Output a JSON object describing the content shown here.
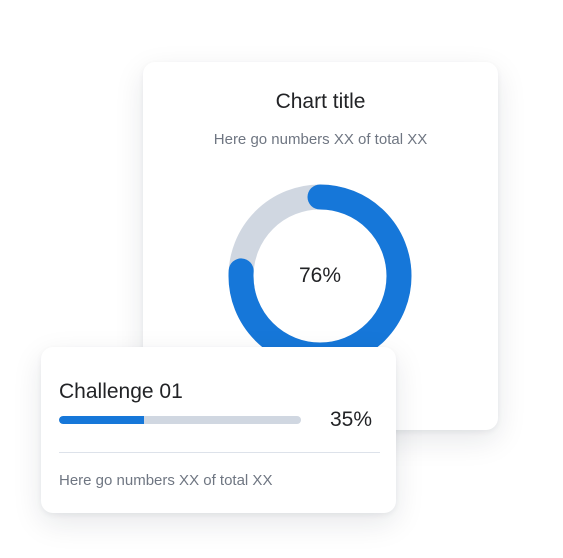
{
  "chart_card": {
    "title": "Chart title",
    "subtitle": "Here go numbers XX of total XX",
    "center_label": "76%"
  },
  "chart_data": {
    "type": "pie",
    "variant": "donut",
    "title": "Chart title",
    "subtitle": "Here go numbers XX of total XX",
    "center_label": "76%",
    "values": [
      76,
      24
    ],
    "colors": [
      "#1677d9",
      "#d0d7e1"
    ]
  },
  "challenge_card": {
    "title": "Challenge 01",
    "percent_label": "35%",
    "progress": 0.35,
    "caption": "Here go numbers XX of total XX"
  },
  "colors": {
    "accent": "#1677d9",
    "track": "#d0d7e1",
    "text": "#222326",
    "muted": "#6f7682"
  }
}
